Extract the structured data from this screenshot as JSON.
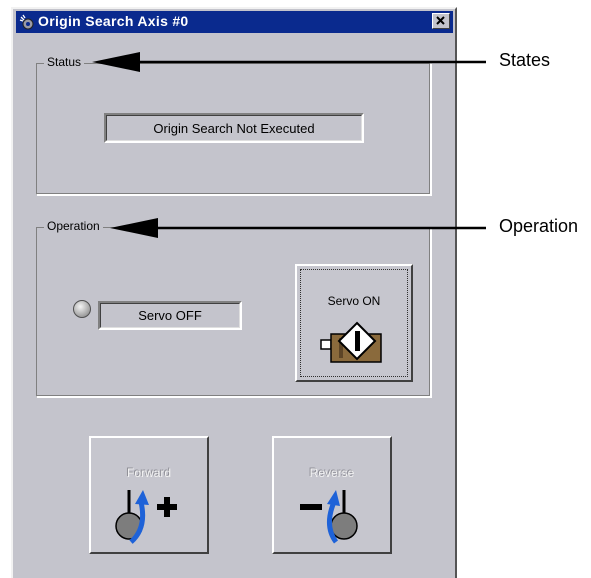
{
  "window": {
    "title": "Origin Search Axis #0",
    "close_label": "✕"
  },
  "status": {
    "group_label": "Status",
    "value": "Origin Search Not Executed"
  },
  "operation": {
    "group_label": "Operation",
    "servo_state": "Servo OFF",
    "servo_button_label": "Servo ON"
  },
  "jog": {
    "forward_label": "Forward",
    "reverse_label": "Reverse",
    "enabled": false
  },
  "callouts": {
    "states": "States",
    "operation": "Operation"
  },
  "colors": {
    "titlebar": "#0a2a8e",
    "window_face": "#c4c4cc",
    "arrow_blue": "#1e62d8"
  }
}
